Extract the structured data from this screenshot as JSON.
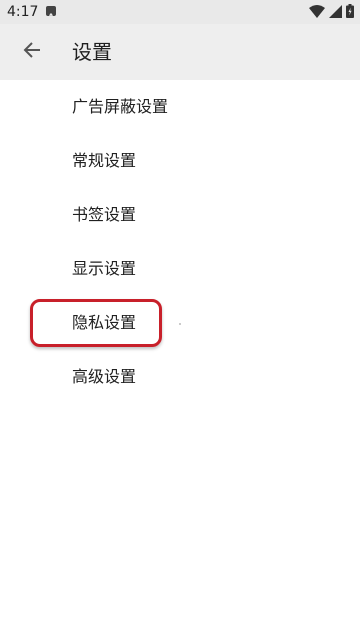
{
  "status_bar": {
    "time": "4:17",
    "icons": [
      "notification-a-icon",
      "wifi-icon",
      "signal-icon",
      "battery-icon"
    ]
  },
  "app_bar": {
    "back_icon": "back-arrow-icon",
    "title": "设置"
  },
  "settings": {
    "items": [
      {
        "label": "广告屏蔽设置"
      },
      {
        "label": "常规设置"
      },
      {
        "label": "书签设置"
      },
      {
        "label": "显示设置"
      },
      {
        "label": "隐私设置",
        "highlighted": true
      },
      {
        "label": "高级设置"
      }
    ]
  },
  "colors": {
    "highlight": "#c8202a",
    "app_bar_bg": "#eeeeee",
    "status_bar_bg": "#e9e9e9"
  }
}
